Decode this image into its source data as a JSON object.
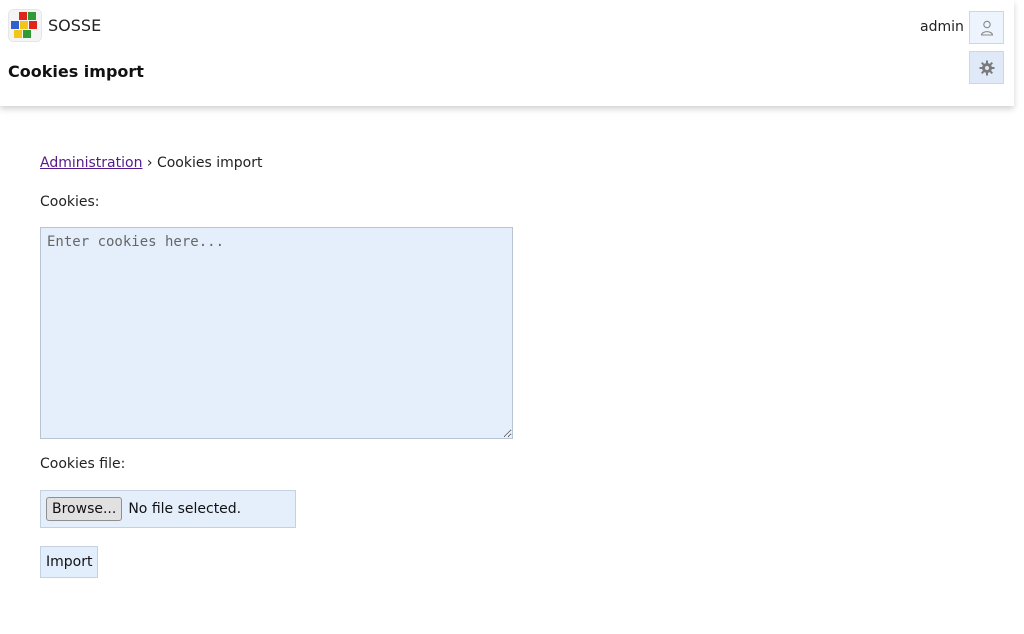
{
  "app": {
    "name": "SOSSE"
  },
  "header": {
    "page_title": "Cookies import",
    "user": "admin"
  },
  "breadcrumb": {
    "parent": "Administration",
    "separator": "›",
    "current": "Cookies import"
  },
  "form": {
    "cookies_label": "Cookies:",
    "cookies_placeholder": "Enter cookies here...",
    "cookies_value": "",
    "file_label": "Cookies file:",
    "browse_label": "Browse...",
    "file_status": "No file selected.",
    "submit_label": "Import"
  },
  "icons": {
    "user": "user-icon",
    "settings": "gear-icon",
    "logo": "sosse-logo"
  },
  "colors": {
    "field_background": "#e5effc",
    "link": "#551a8b",
    "logo_red": "#e0261b",
    "logo_green": "#2f9b34",
    "logo_yellow": "#f2c618",
    "logo_blue": "#2f5fd0"
  }
}
